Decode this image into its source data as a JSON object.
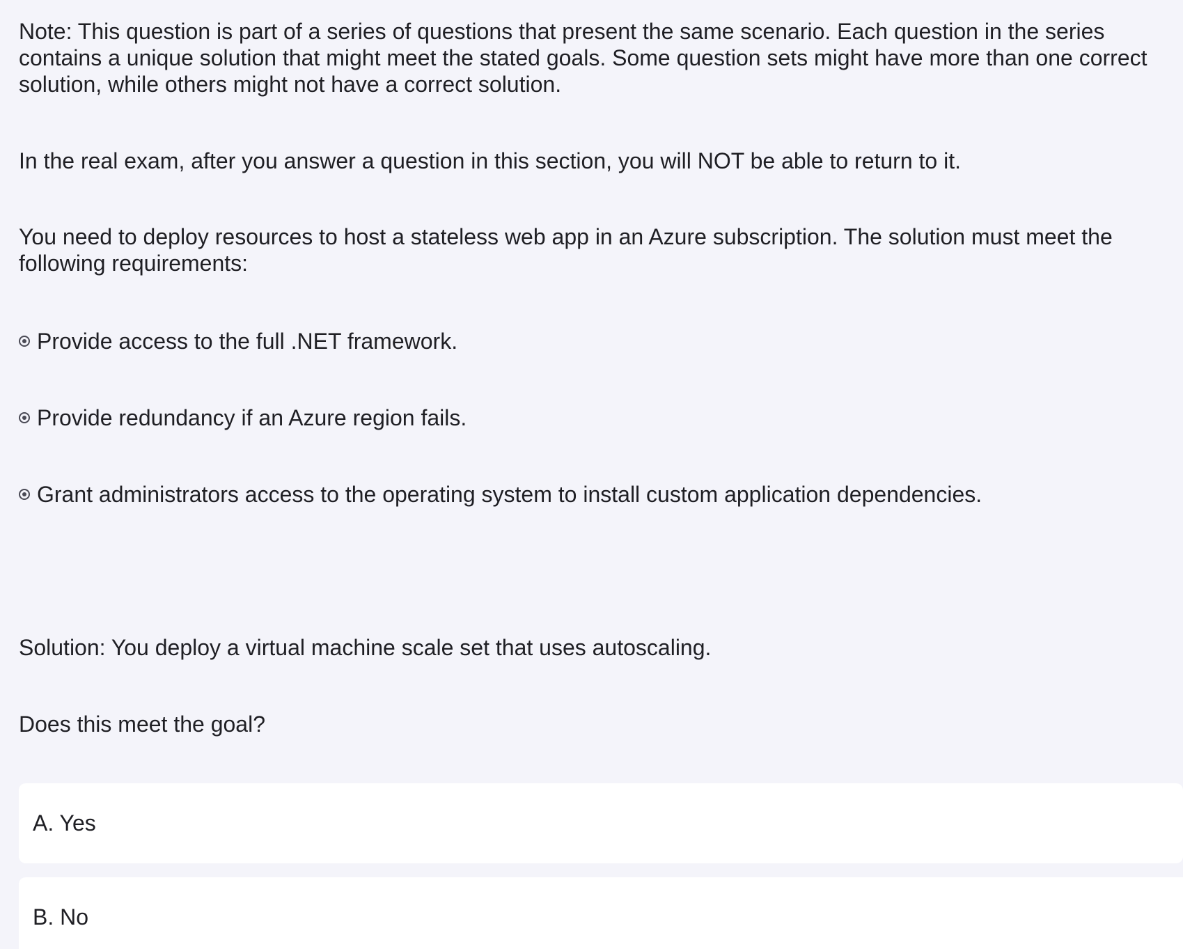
{
  "question": {
    "note": "Note: This question is part of a series of questions that present the same scenario. Each question in the series contains a unique solution that might meet the stated goals. Some question sets might have more than one correct solution, while others might not have a correct solution.",
    "exam_notice": "In the real exam, after you answer a question in this section, you will NOT be able to return to it.",
    "scenario": "You need to deploy resources to host a stateless web app in an Azure subscription. The solution must meet the following requirements:",
    "requirements": [
      "Provide access to the full .NET framework.",
      "Provide redundancy if an Azure region fails.",
      "Grant administrators access to the operating system to install custom application dependencies."
    ],
    "solution": "Solution: You deploy a virtual machine scale set that uses autoscaling.",
    "prompt": "Does this meet the goal?"
  },
  "options": [
    {
      "label": "A. Yes"
    },
    {
      "label": "B. No"
    }
  ],
  "colors": {
    "background": "#f4f4fa",
    "card": "#ffffff",
    "text": "#1f1f24"
  }
}
